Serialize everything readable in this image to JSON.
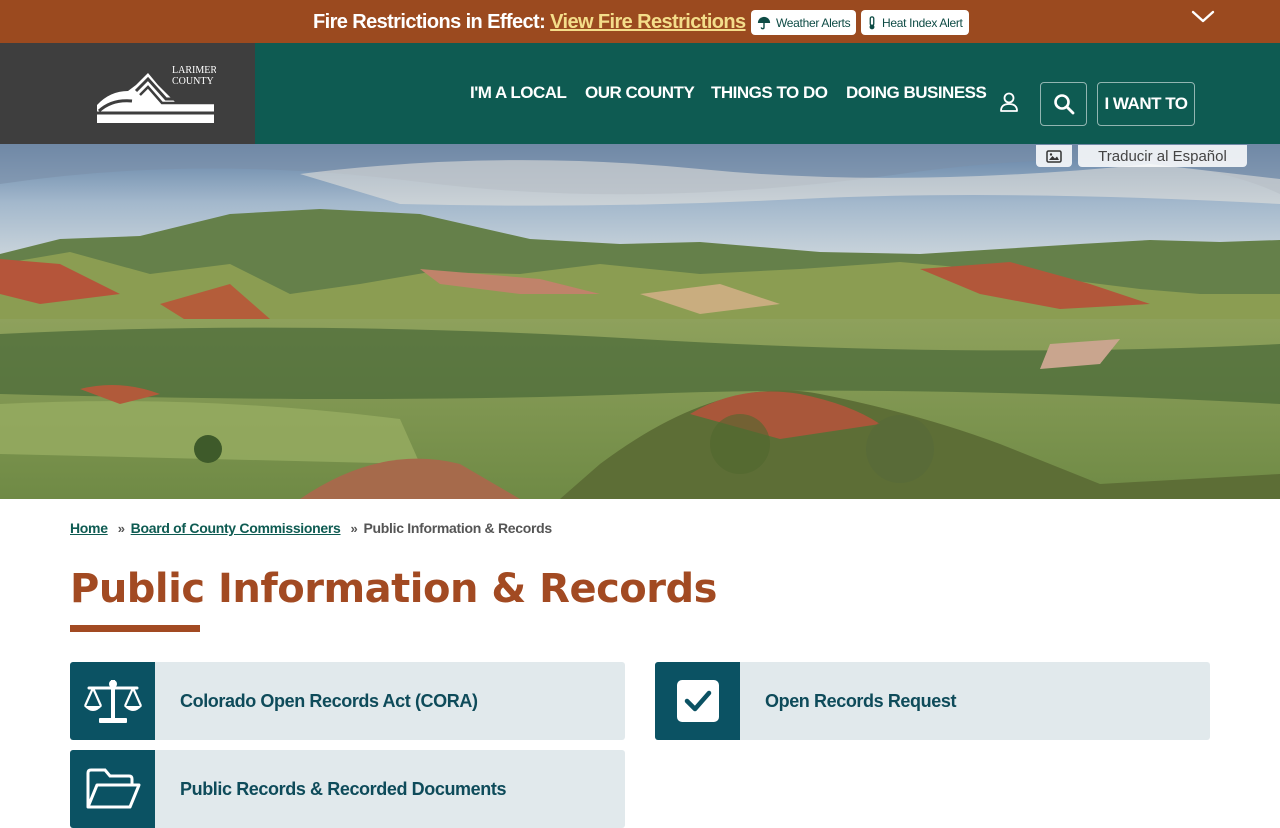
{
  "alert": {
    "title": "Fire Restrictions in Effect:",
    "link_label": "View Fire Restrictions",
    "weather_label": "Weather Alerts",
    "heat_label": "Heat Index Alert"
  },
  "logo": {
    "line1": "LARIMER",
    "line2": "COUNTY"
  },
  "nav": {
    "items": [
      "I'M A LOCAL",
      "OUR COUNTY",
      "THINGS TO DO",
      "DOING BUSINESS"
    ],
    "want_to": "I WANT TO"
  },
  "hero": {
    "translate_label": "Traducir al Español"
  },
  "breadcrumb": {
    "home": "Home",
    "parent": "Board of County Commissioners",
    "separator": "»",
    "current": "Public Information & Records"
  },
  "page": {
    "title": "Public Information & Records"
  },
  "cards": [
    {
      "label": "Colorado Open Records Act (CORA)",
      "icon": "scales-icon"
    },
    {
      "label": "Open Records Request",
      "icon": "checkbox-icon"
    },
    {
      "label": "Public Records & Recorded Documents",
      "icon": "folder-open-icon"
    }
  ],
  "colors": {
    "alert_bg": "#9b4a1f",
    "nav_bg": "#0e5b52",
    "logo_bg": "#3e3e3e",
    "title": "#a24a22",
    "card_bg": "#e1e9ec",
    "card_icon_bg": "#0b5263"
  }
}
